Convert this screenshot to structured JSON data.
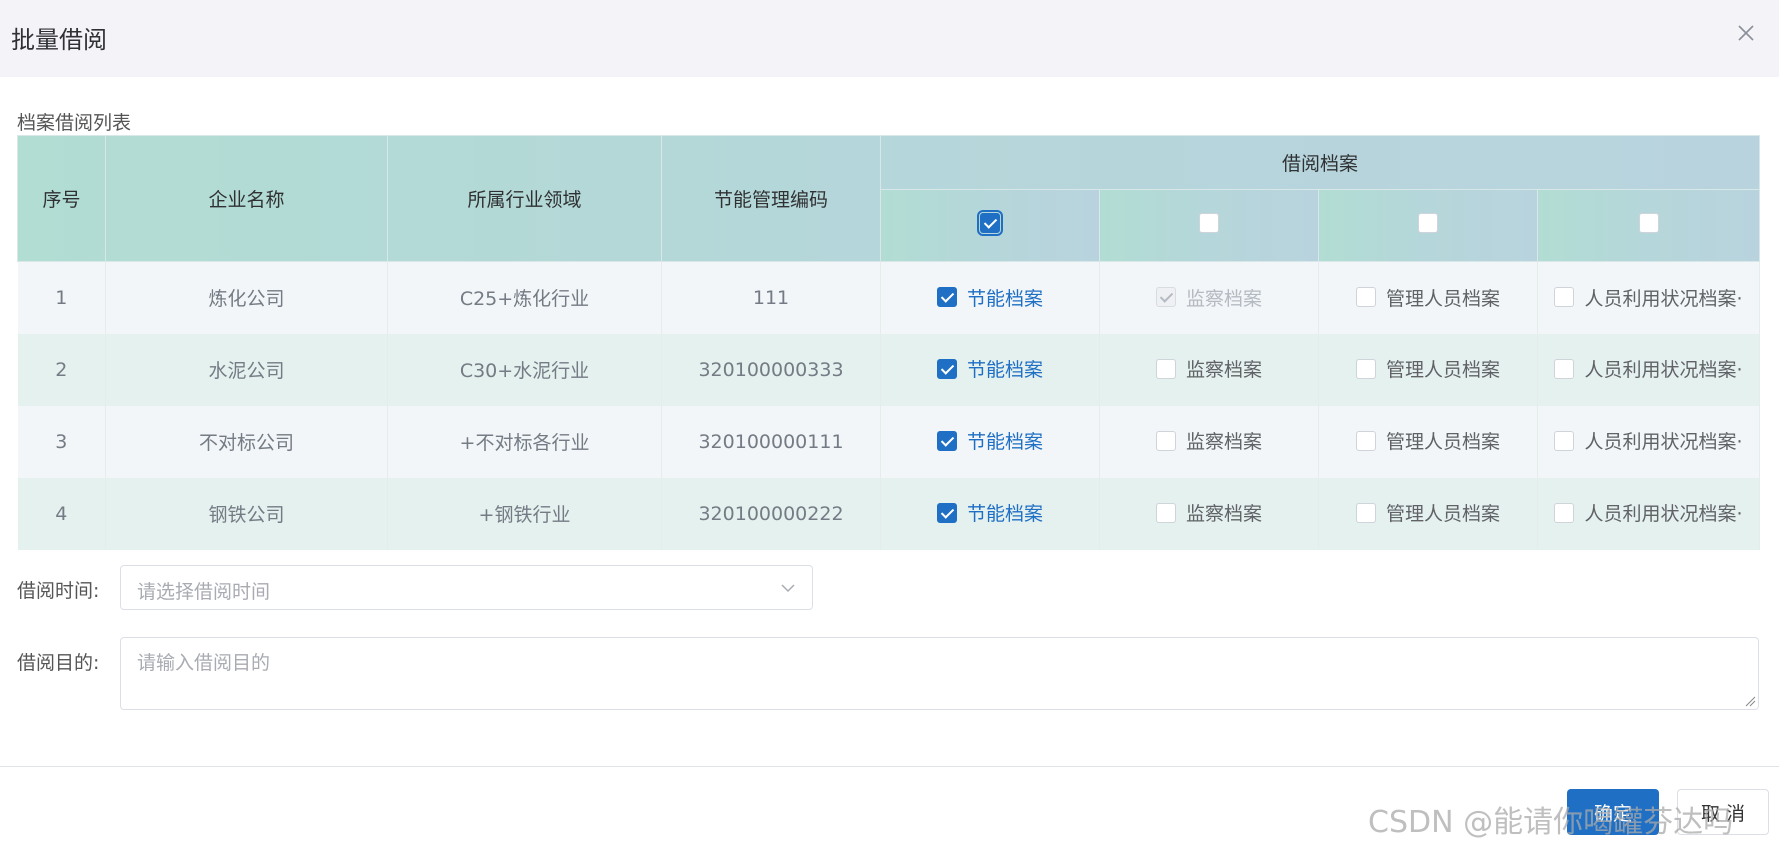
{
  "dialog": {
    "title": "批量借阅"
  },
  "table": {
    "section_title": "档案借阅列表",
    "columns": {
      "index": "序号",
      "company": "企业名称",
      "industry": "所属行业领域",
      "code": "节能管理编码",
      "group": "借阅档案"
    },
    "header_checks": [
      true,
      false,
      false,
      false
    ],
    "rows": [
      {
        "index": "1",
        "company": "炼化公司",
        "industry": "C25+炼化行业",
        "code": "111",
        "files": [
          {
            "label": "节能档案",
            "state": "checked"
          },
          {
            "label": "监察档案",
            "state": "disabled"
          },
          {
            "label": "管理人员档案",
            "state": "unchecked"
          },
          {
            "label": "人员利用状况档案·",
            "state": "unchecked"
          }
        ]
      },
      {
        "index": "2",
        "company": "水泥公司",
        "industry": "C30+水泥行业",
        "code": "320100000333",
        "files": [
          {
            "label": "节能档案",
            "state": "checked"
          },
          {
            "label": "监察档案",
            "state": "unchecked"
          },
          {
            "label": "管理人员档案",
            "state": "unchecked"
          },
          {
            "label": "人员利用状况档案·",
            "state": "unchecked"
          }
        ]
      },
      {
        "index": "3",
        "company": "不对标公司",
        "industry": "+不对标各行业",
        "code": "320100000111",
        "files": [
          {
            "label": "节能档案",
            "state": "checked"
          },
          {
            "label": "监察档案",
            "state": "unchecked"
          },
          {
            "label": "管理人员档案",
            "state": "unchecked"
          },
          {
            "label": "人员利用状况档案·",
            "state": "unchecked"
          }
        ]
      },
      {
        "index": "4",
        "company": "钢铁公司",
        "industry": "+钢铁行业",
        "code": "320100000222",
        "files": [
          {
            "label": "节能档案",
            "state": "checked"
          },
          {
            "label": "监察档案",
            "state": "unchecked"
          },
          {
            "label": "管理人员档案",
            "state": "unchecked"
          },
          {
            "label": "人员利用状况档案·",
            "state": "unchecked"
          }
        ]
      }
    ]
  },
  "form": {
    "time_label": "借阅时间:",
    "time_placeholder": "请选择借阅时间",
    "purpose_label": "借阅目的:",
    "purpose_placeholder": "请输入借阅目的"
  },
  "footer": {
    "ok_label": "确定",
    "cancel_label": "取 消"
  },
  "watermark": "CSDN @能请你喝罐芬达吗",
  "colors": {
    "primary": "#1f6fc4",
    "header_teal": "#b1ddd3",
    "row_alt": "#e5f1ef"
  }
}
